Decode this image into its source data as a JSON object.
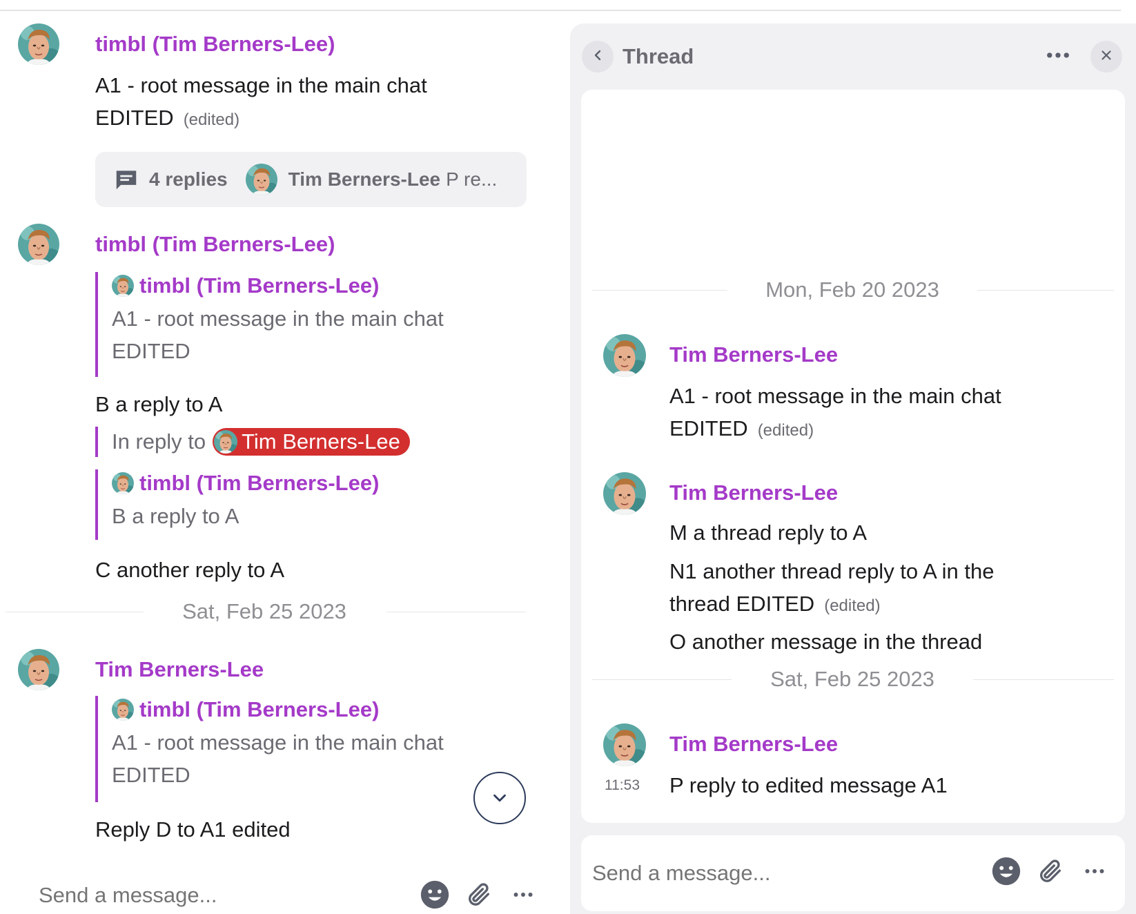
{
  "main": {
    "messages": [
      {
        "author": "timbl (Tim Berners-Lee)",
        "text_line1": "A1 - root message in the main chat",
        "text_line2": "EDITED",
        "edited_label": "(edited)",
        "replies": {
          "count_label": "4 replies",
          "last_reply_name": "Tim Berners-Lee",
          "last_reply_preview": "P re..."
        }
      },
      {
        "author": "timbl (Tim Berners-Lee)",
        "quote1": {
          "author": "timbl (Tim Berners-Lee)",
          "line1": "A1 - root message in the main chat",
          "line2": "EDITED"
        },
        "text_b": "B a reply to A",
        "in_reply_to": "In reply to",
        "mention_name": "Tim Berners-Lee",
        "quote2": {
          "author": "timbl (Tim Berners-Lee)",
          "line1": "B a reply to A"
        },
        "text_c": "C another reply to A"
      },
      {
        "author": "Tim Berners-Lee",
        "quote": {
          "author": "timbl (Tim Berners-Lee)",
          "line1": "A1 - root message in the main chat",
          "line2": "EDITED"
        },
        "text": "Reply D to A1 edited"
      }
    ],
    "date_separator": "Sat, Feb 25 2023",
    "composer": {
      "placeholder": "Send a message..."
    }
  },
  "thread": {
    "title": "Thread",
    "date_separator_1": "Mon, Feb 20 2023",
    "date_separator_2": "Sat, Feb 25 2023",
    "messages": [
      {
        "author": "Tim Berners-Lee",
        "line1": "A1 - root message in the main chat",
        "line2": "EDITED",
        "edited_label": "(edited)"
      },
      {
        "author": "Tim Berners-Lee",
        "text_m": "M a thread reply to A",
        "text_n_line1": "N1 another thread reply to A in the",
        "text_n_line2": "thread EDITED",
        "edited_label": "(edited)",
        "text_o": "O another message in the thread"
      },
      {
        "author": "Tim Berners-Lee",
        "time": "11:53",
        "text": "P reply to edited message A1"
      }
    ],
    "composer": {
      "placeholder": "Send a message..."
    }
  },
  "icons": {
    "back": "chevron-left-icon",
    "more": "more-horizontal-icon",
    "close": "close-icon",
    "emoji": "emoji-icon",
    "attach": "paperclip-icon",
    "replies": "chat-bubble-icon",
    "scroll": "chevron-down-icon"
  },
  "colors": {
    "author": "#a43ac8",
    "mention": "#d32f2f",
    "panel_bg": "#f1f1f4"
  }
}
